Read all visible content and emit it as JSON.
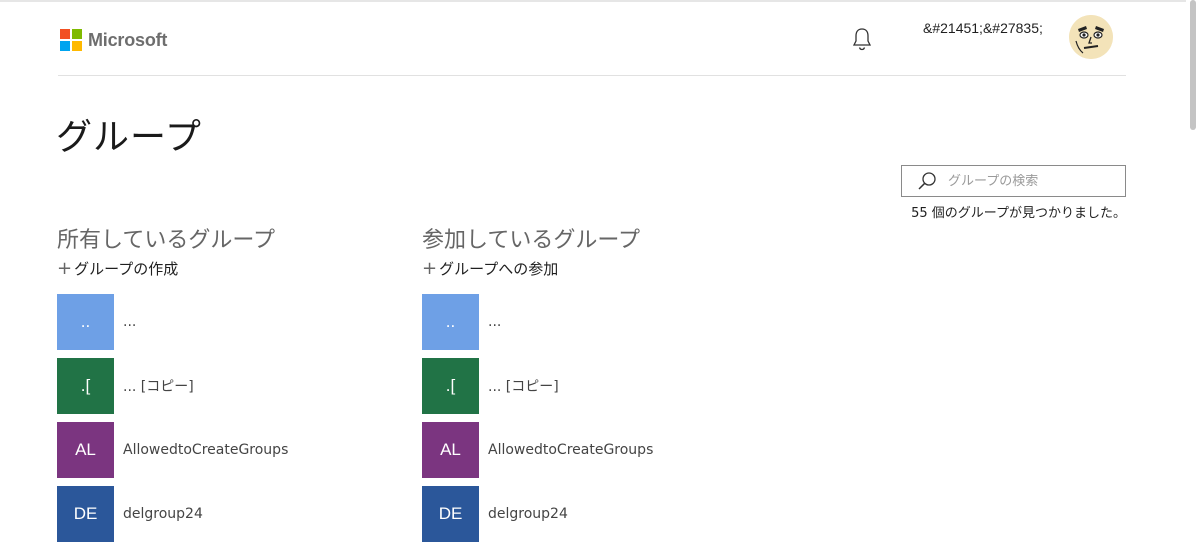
{
  "header": {
    "logo_text": "Microsoft",
    "logo_colors": [
      "#f25022",
      "#7fba00",
      "#00a4ef",
      "#ffb900"
    ],
    "user_name": "&#21451;&#27835;",
    "avatar": "avatar-face-icon"
  },
  "page": {
    "title": "グループ"
  },
  "search": {
    "placeholder": "グループの検索",
    "result_count": "55 個のグループが見つかりました。"
  },
  "owned": {
    "title": "所有しているグループ",
    "action_plus": "+",
    "action_label": "グループの作成",
    "groups": [
      {
        "initials": "..",
        "name": "...",
        "color": "#6ea0e6"
      },
      {
        "initials": ".[",
        "name": "... [コピー]",
        "color": "#217346"
      },
      {
        "initials": "AL",
        "name": "AllowedtoCreateGroups",
        "color": "#7b3580"
      },
      {
        "initials": "DE",
        "name": "delgroup24",
        "color": "#2b579a"
      }
    ]
  },
  "member": {
    "title": "参加しているグループ",
    "action_plus": "+",
    "action_label": "グループへの参加",
    "groups": [
      {
        "initials": "..",
        "name": "...",
        "color": "#6ea0e6"
      },
      {
        "initials": ".[",
        "name": "... [コピー]",
        "color": "#217346"
      },
      {
        "initials": "AL",
        "name": "AllowedtoCreateGroups",
        "color": "#7b3580"
      },
      {
        "initials": "DE",
        "name": "delgroup24",
        "color": "#2b579a"
      }
    ]
  }
}
